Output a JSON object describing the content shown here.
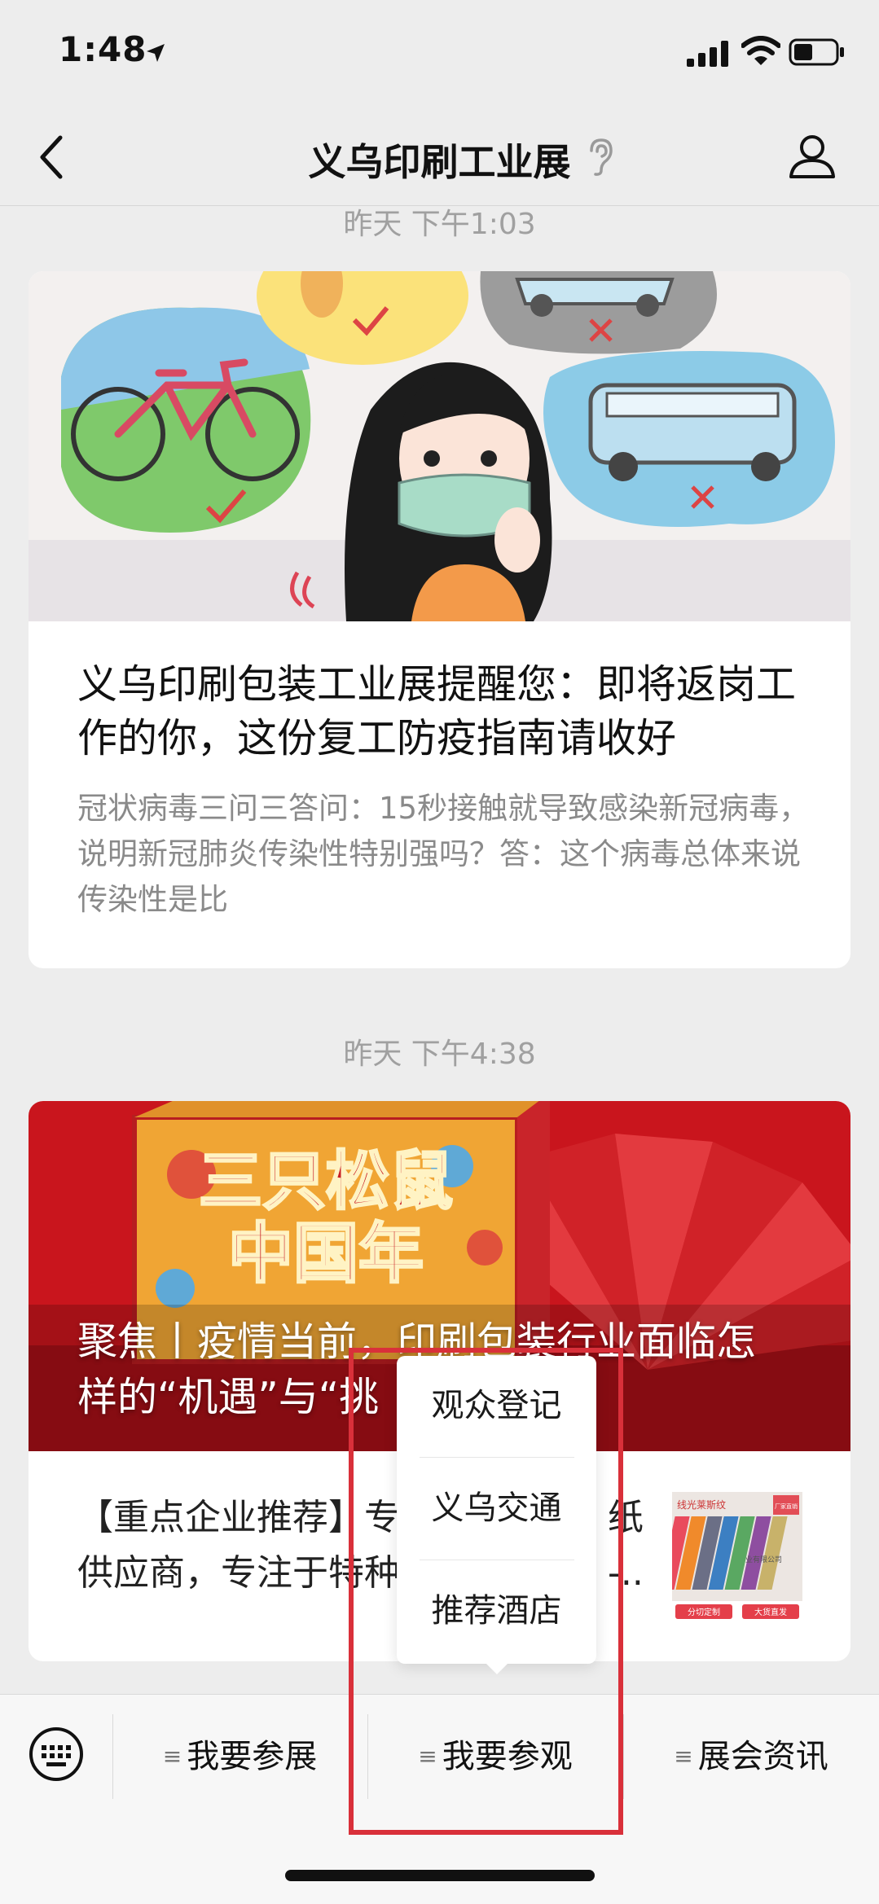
{
  "status_bar": {
    "time": "1:48",
    "icons": [
      "location-arrow-icon",
      "signal-bars-icon",
      "wifi-icon",
      "battery-icon"
    ]
  },
  "nav": {
    "title": "义乌印刷工业展",
    "icons": [
      "back-chevron-icon",
      "ear-icon",
      "profile-icon"
    ]
  },
  "messages": [
    {
      "timestamp": "昨天 下午1:03",
      "title": "义乌印刷包装工业展提醒您：即将返岗工作的你，这份复工防疫指南请收好",
      "description": "冠状病毒三问三答问：15秒接触就导致感染新冠病毒，说明新冠肺炎传染性特别强吗？答：这个病毒总体来说传染性是比"
    },
    {
      "timestamp": "昨天 下午4:38",
      "banner_title_line1": "聚焦丨疫情当前，印刷包装行业面临怎",
      "banner_title_line2": "样的“机遇”与“挑",
      "banner_poster_text": "三只松鼠 中国年",
      "sub_line1": "【重点企业推荐】专",
      "sub_line1_tail": "纸",
      "sub_line2": "供应商，专注于特种",
      "sub_line2_tail": "-..",
      "thumb_top_text": "线光莱斯纹",
      "thumb_badge": "厂家直销",
      "thumb_company": "业有限公司",
      "thumb_bottom_left": "分切定制",
      "thumb_bottom_right": "大货直发"
    }
  ],
  "popup_menu": {
    "items": [
      "观众登记",
      "义乌交通",
      "推荐酒店"
    ]
  },
  "bottom_menu": {
    "keyboard_icon": "keyboard-icon",
    "items": [
      "我要参展",
      "我要参观",
      "展会资讯"
    ],
    "item_glyph": "≡"
  },
  "colors": {
    "background": "#ededed",
    "card": "#ffffff",
    "highlight": "#d9303a",
    "banner_red": "#d8232a"
  }
}
